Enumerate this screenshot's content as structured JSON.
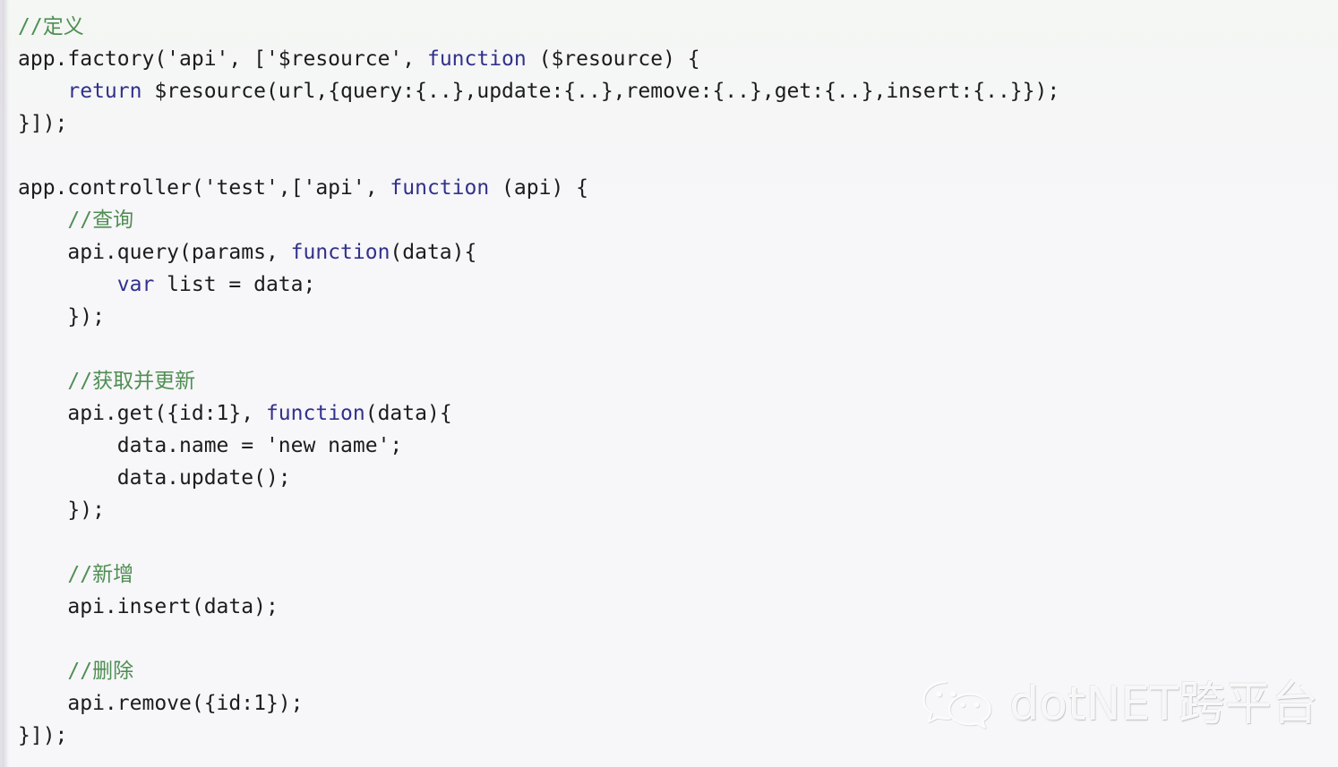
{
  "theme": {
    "background_top": "#f4f7f3",
    "background_bottom": "#f7f6f9",
    "text_color": "#1c1c1c",
    "comment_color": "#4f8f53",
    "keyword_color": "#31318c",
    "left_border_color": "#e2e0e6"
  },
  "code": {
    "language": "javascript",
    "lines": [
      {
        "indent": 0,
        "blank": false,
        "tokens": [
          {
            "t": "comment",
            "s": "//定义"
          }
        ]
      },
      {
        "indent": 0,
        "blank": false,
        "tokens": [
          {
            "t": "plain",
            "s": "app.factory('api', ['$resource', "
          },
          {
            "t": "keyword",
            "s": "function"
          },
          {
            "t": "plain",
            "s": " ($resource) {"
          }
        ]
      },
      {
        "indent": 1,
        "blank": false,
        "tokens": [
          {
            "t": "keyword",
            "s": "return"
          },
          {
            "t": "plain",
            "s": " $resource(url,{query:{..},update:{..},remove:{..},get:{..},insert:{..}});"
          }
        ]
      },
      {
        "indent": 0,
        "blank": false,
        "tokens": [
          {
            "t": "plain",
            "s": "}]);"
          }
        ]
      },
      {
        "indent": 0,
        "blank": true,
        "tokens": []
      },
      {
        "indent": 0,
        "blank": false,
        "tokens": [
          {
            "t": "plain",
            "s": "app.controller('test',['api', "
          },
          {
            "t": "keyword",
            "s": "function"
          },
          {
            "t": "plain",
            "s": " (api) {"
          }
        ]
      },
      {
        "indent": 1,
        "blank": false,
        "tokens": [
          {
            "t": "comment",
            "s": "//查询"
          }
        ]
      },
      {
        "indent": 1,
        "blank": false,
        "tokens": [
          {
            "t": "plain",
            "s": "api.query(params, "
          },
          {
            "t": "keyword",
            "s": "function"
          },
          {
            "t": "plain",
            "s": "(data){"
          }
        ]
      },
      {
        "indent": 2,
        "blank": false,
        "tokens": [
          {
            "t": "keyword",
            "s": "var"
          },
          {
            "t": "plain",
            "s": " list = data;"
          }
        ]
      },
      {
        "indent": 1,
        "blank": false,
        "tokens": [
          {
            "t": "plain",
            "s": "});"
          }
        ]
      },
      {
        "indent": 0,
        "blank": true,
        "tokens": []
      },
      {
        "indent": 1,
        "blank": false,
        "tokens": [
          {
            "t": "comment",
            "s": "//获取并更新"
          }
        ]
      },
      {
        "indent": 1,
        "blank": false,
        "tokens": [
          {
            "t": "plain",
            "s": "api.get({id:1}, "
          },
          {
            "t": "keyword",
            "s": "function"
          },
          {
            "t": "plain",
            "s": "(data){"
          }
        ]
      },
      {
        "indent": 2,
        "blank": false,
        "tokens": [
          {
            "t": "plain",
            "s": "data.name = 'new name';"
          }
        ]
      },
      {
        "indent": 2,
        "blank": false,
        "tokens": [
          {
            "t": "plain",
            "s": "data.update();"
          }
        ]
      },
      {
        "indent": 1,
        "blank": false,
        "tokens": [
          {
            "t": "plain",
            "s": "});"
          }
        ]
      },
      {
        "indent": 0,
        "blank": true,
        "tokens": []
      },
      {
        "indent": 1,
        "blank": false,
        "tokens": [
          {
            "t": "comment",
            "s": "//新增"
          }
        ]
      },
      {
        "indent": 1,
        "blank": false,
        "tokens": [
          {
            "t": "plain",
            "s": "api.insert(data);"
          }
        ]
      },
      {
        "indent": 0,
        "blank": true,
        "tokens": []
      },
      {
        "indent": 1,
        "blank": false,
        "tokens": [
          {
            "t": "comment",
            "s": "//删除"
          }
        ]
      },
      {
        "indent": 1,
        "blank": false,
        "tokens": [
          {
            "t": "plain",
            "s": "api.remove({id:1});"
          }
        ]
      },
      {
        "indent": 0,
        "blank": false,
        "tokens": [
          {
            "t": "plain",
            "s": "}]);"
          }
        ]
      }
    ]
  },
  "watermark": {
    "icon": "wechat-logo-icon",
    "text": "dotNET跨平台"
  }
}
